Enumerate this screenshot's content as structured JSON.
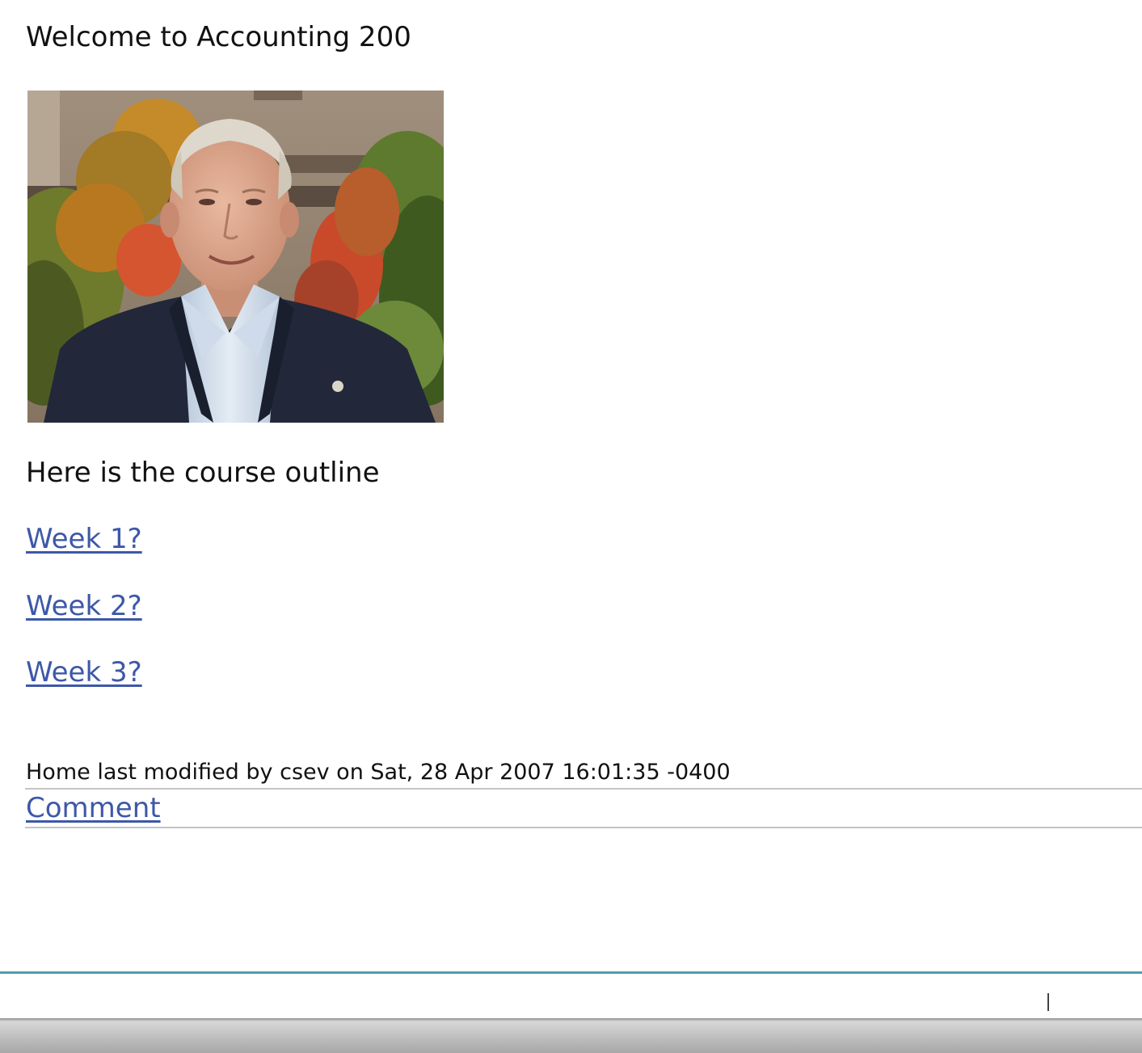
{
  "page": {
    "welcome": "Welcome to Accounting 200",
    "photo_alt": "Instructor portrait",
    "outline_intro": "Here is the course outline",
    "weeks": [
      {
        "label": "Week 1?"
      },
      {
        "label": "Week 2?"
      },
      {
        "label": "Week 3?"
      }
    ]
  },
  "footer": {
    "modified": "Home last modified by csev on Sat, 28 Apr 2007 16:01:35 -0400",
    "comment_label": "Comment"
  },
  "colors": {
    "link": "#3d58a8",
    "divider": "#c4c4c4",
    "accent_rule": "#4f9eac"
  }
}
